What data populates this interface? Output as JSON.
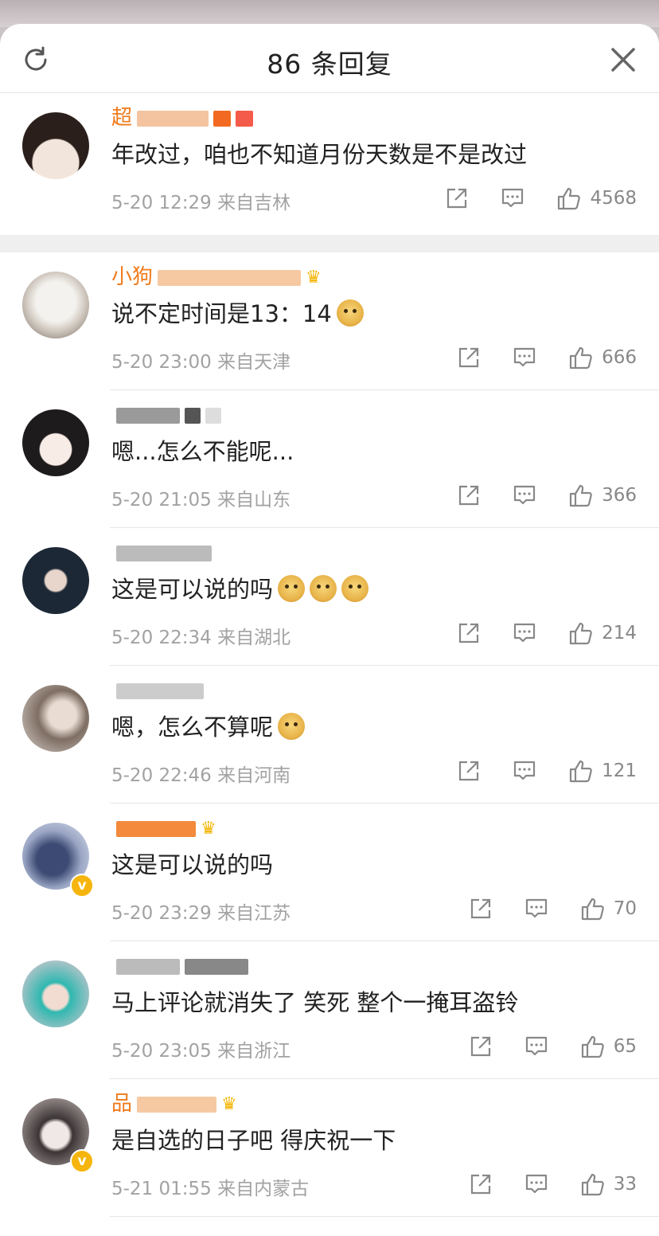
{
  "header": {
    "title": "86 条回复"
  },
  "comments": [
    {
      "username": "超",
      "text": "年改过，咱也不知道月份天数是不是改过",
      "date": "5-20 12:29",
      "location": "来自吉林",
      "likes": "4568",
      "has_emoji": false
    },
    {
      "username": "小狗",
      "text": "说不定时间是13：14",
      "date": "5-20 23:00",
      "location": "来自天津",
      "likes": "666",
      "has_emoji": true
    },
    {
      "username": "",
      "text": "嗯...怎么不能呢...",
      "date": "5-20 21:05",
      "location": "来自山东",
      "likes": "366",
      "has_emoji": false
    },
    {
      "username": "",
      "text": "这是可以说的吗",
      "date": "5-20 22:34",
      "location": "来自湖北",
      "likes": "214",
      "has_emoji": true
    },
    {
      "username": "",
      "text": "嗯，怎么不算呢",
      "date": "5-20 22:46",
      "location": "来自河南",
      "likes": "121",
      "has_emoji": true
    },
    {
      "username": "",
      "text": "这是可以说的吗",
      "date": "5-20 23:29",
      "location": "来自江苏",
      "likes": "70",
      "has_emoji": false
    },
    {
      "username": "",
      "text": "马上评论就消失了 笑死  整个一掩耳盗铃",
      "date": "5-20 23:05",
      "location": "来自浙江",
      "likes": "65",
      "has_emoji": false
    },
    {
      "username": "品",
      "text": "是自选的日子吧 得庆祝一下",
      "date": "5-21 01:55",
      "location": "来自内蒙古",
      "likes": "33",
      "has_emoji": false
    }
  ],
  "colors": {
    "accent_orange": "#f07a1a",
    "verified": "#f5b50c",
    "meta_gray": "#a2a2a2"
  }
}
